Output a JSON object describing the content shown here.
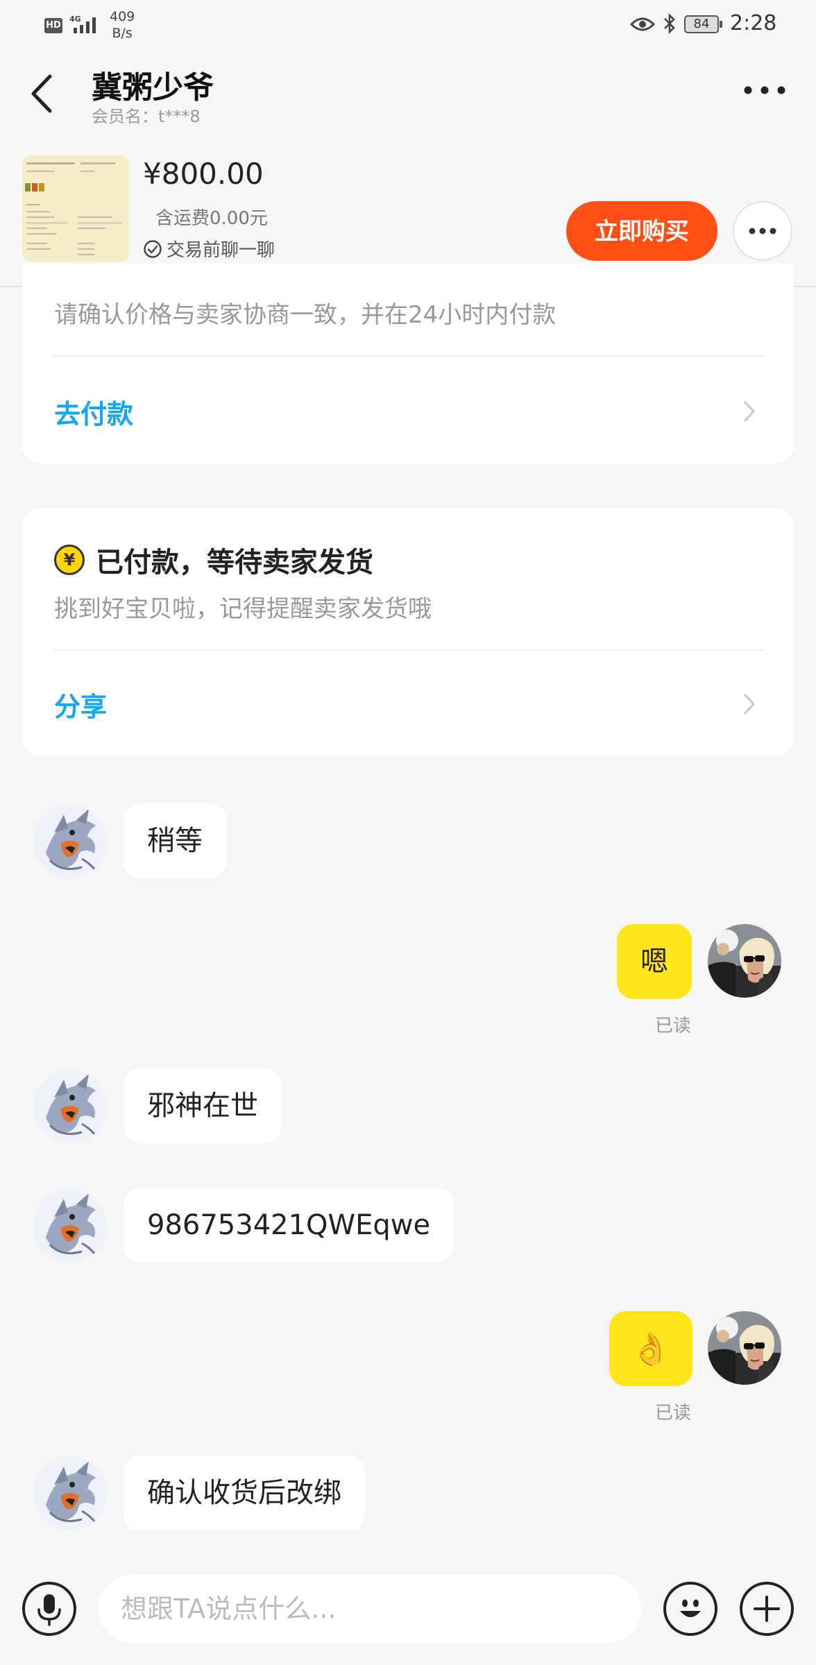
{
  "status_bar": {
    "hd_label": "HD",
    "network": "4G",
    "speed_value": "409",
    "speed_unit": "B/s",
    "battery": "84",
    "time": "2:28"
  },
  "header": {
    "title": "冀粥少爷",
    "subtitle": "会员名：t***8",
    "back_icon": "chevron-left-icon",
    "more_icon": "more-horizontal-icon"
  },
  "product": {
    "price": "¥800.00",
    "shipping": "含运费0.00元",
    "chat_first": "交易前聊一聊",
    "buy_button": "立即购买",
    "more_icon": "more-horizontal-icon"
  },
  "cards": {
    "payment": {
      "notice": "请确认价格与卖家协商一致，并在24小时内付款",
      "action": "去付款"
    },
    "paid": {
      "coin_symbol": "¥",
      "title": "已付款，等待卖家发货",
      "notice": "挑到好宝贝啦，记得提醒卖家发货哦",
      "action": "分享"
    }
  },
  "messages": [
    {
      "side": "in",
      "text": "稍等"
    },
    {
      "side": "out",
      "text": "嗯",
      "status": "已读"
    },
    {
      "side": "in",
      "text": "邪神在世"
    },
    {
      "side": "in",
      "text": "986753421QWEqwe"
    },
    {
      "side": "out",
      "text": "👌",
      "status": "已读"
    },
    {
      "side": "in",
      "text": "确认收货后改绑"
    }
  ],
  "input_bar": {
    "placeholder": "想跟TA说点什么...",
    "value": ""
  },
  "colors": {
    "accent_orange": "#ff4f14",
    "link_blue": "#14a7f0",
    "outgoing_bubble": "#ffe41a",
    "background": "#f6f6f6"
  }
}
